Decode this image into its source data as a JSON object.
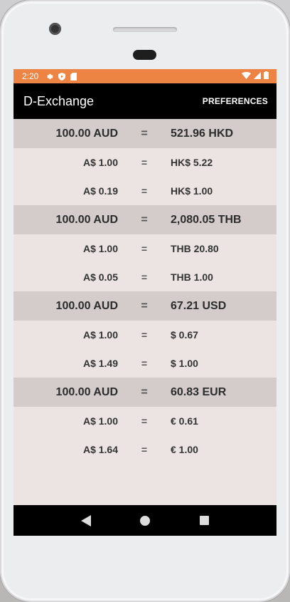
{
  "status_bar": {
    "time": "2:20",
    "icons_left": [
      "settings-icon",
      "shield-icon",
      "sd-card-icon"
    ],
    "icons_right": [
      "wifi-icon",
      "signal-icon",
      "battery-icon"
    ],
    "color": "#ed8444"
  },
  "app_bar": {
    "title": "D-Exchange",
    "preferences_label": "PREFERENCES"
  },
  "conversions": [
    {
      "header": {
        "left": "100.00 AUD",
        "eq": "=",
        "right": "521.96 HKD"
      },
      "rows": [
        {
          "left": "A$ 1.00",
          "eq": "=",
          "right": "HK$ 5.22"
        },
        {
          "left": "A$ 0.19",
          "eq": "=",
          "right": "HK$ 1.00"
        }
      ]
    },
    {
      "header": {
        "left": "100.00 AUD",
        "eq": "=",
        "right": "2,080.05 THB"
      },
      "rows": [
        {
          "left": "A$ 1.00",
          "eq": "=",
          "right": "THB 20.80"
        },
        {
          "left": "A$ 0.05",
          "eq": "=",
          "right": "THB 1.00"
        }
      ]
    },
    {
      "header": {
        "left": "100.00 AUD",
        "eq": "=",
        "right": "67.21 USD"
      },
      "rows": [
        {
          "left": "A$ 1.00",
          "eq": "=",
          "right": "$ 0.67"
        },
        {
          "left": "A$ 1.49",
          "eq": "=",
          "right": "$ 1.00"
        }
      ]
    },
    {
      "header": {
        "left": "100.00 AUD",
        "eq": "=",
        "right": "60.83 EUR"
      },
      "rows": [
        {
          "left": "A$ 1.00",
          "eq": "=",
          "right": "€ 0.61"
        },
        {
          "left": "A$ 1.64",
          "eq": "=",
          "right": "€ 1.00"
        }
      ]
    }
  ],
  "nav_bar": {
    "buttons": [
      "back-icon",
      "home-icon",
      "recents-icon"
    ]
  }
}
